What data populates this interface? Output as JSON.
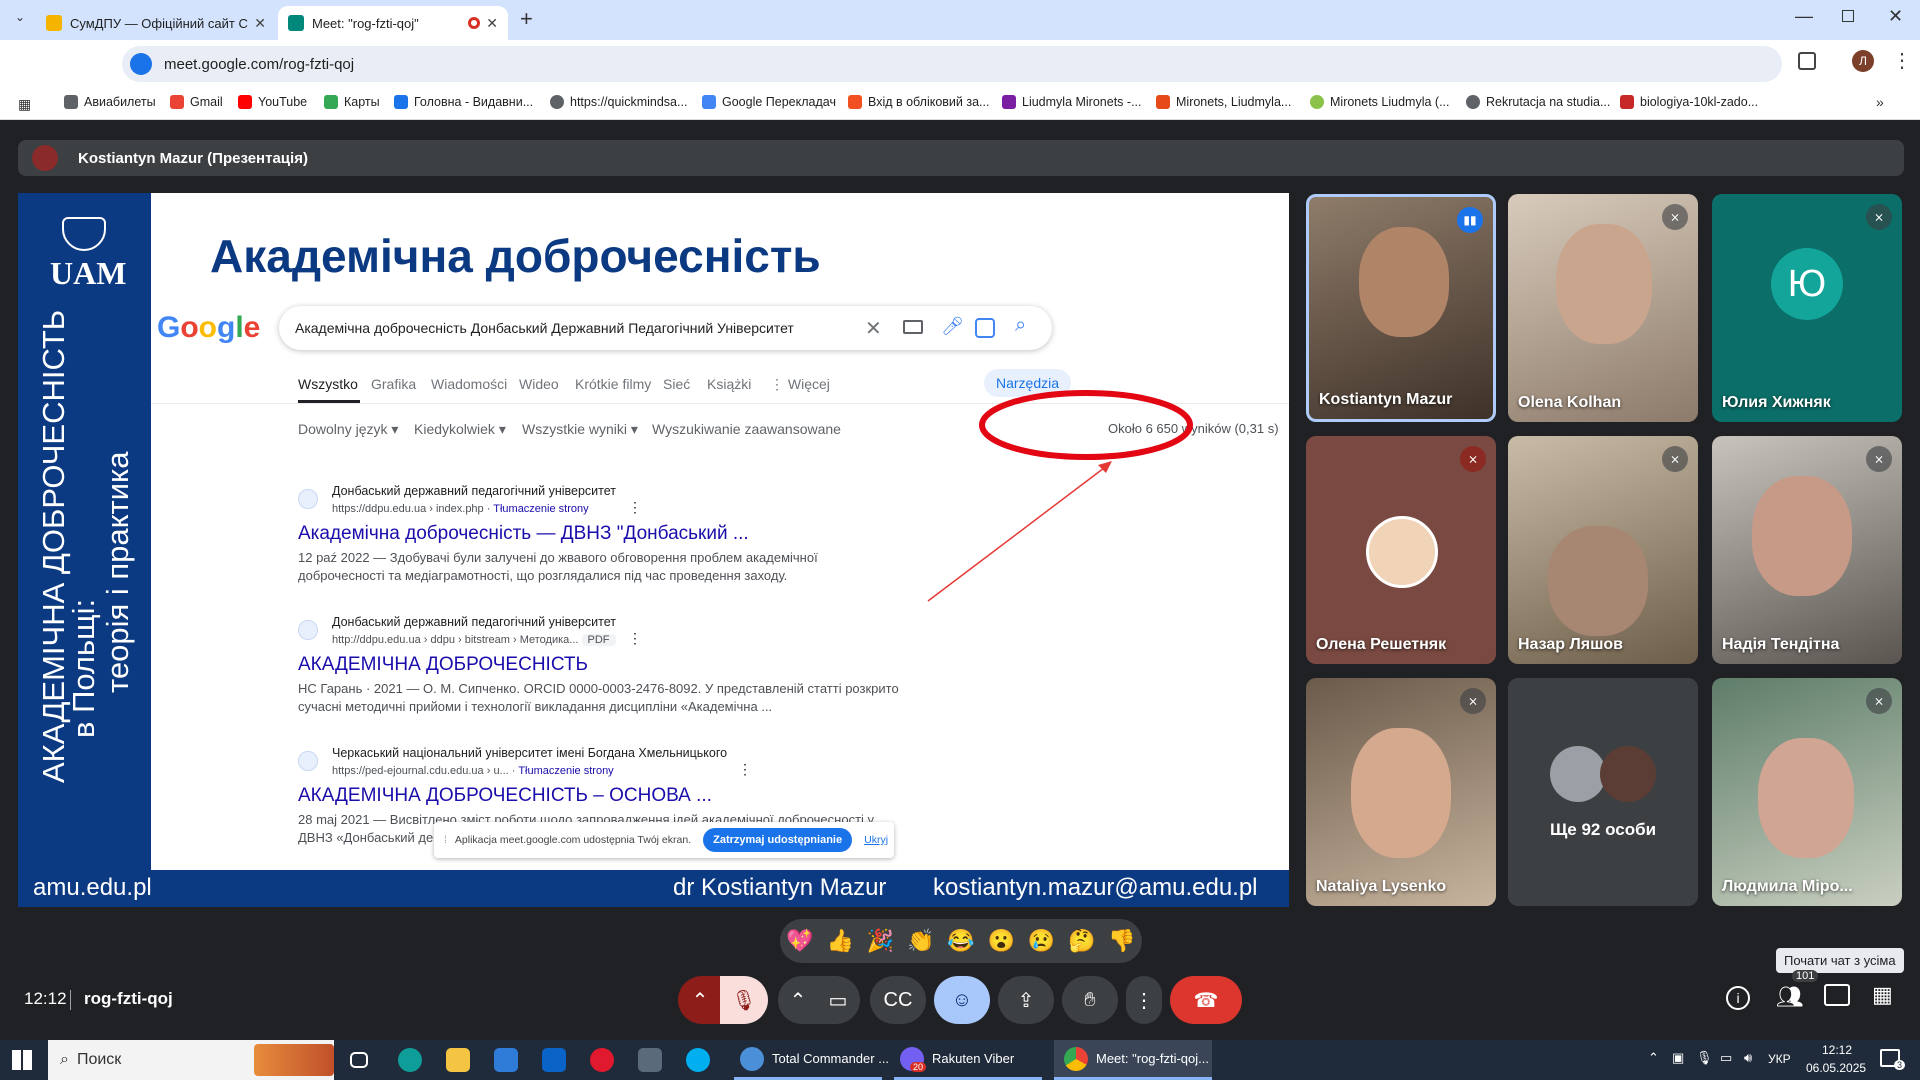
{
  "browser": {
    "tabs": [
      {
        "title": "СумДПУ — Офіційний сайт Сум",
        "active": false
      },
      {
        "title": "Meet: \"rog-fzti-qoj\"",
        "active": true
      }
    ],
    "address": "meet.google.com/rog-fzti-qoj",
    "bookmarks": [
      "Авиабилеты",
      "Gmail",
      "YouTube",
      "Карты",
      "Головна - Видавни...",
      "https://quickmindsa...",
      "Google Перекладач",
      "Вхід в обліковий за...",
      "Liudmyla Mironets -...",
      "Mironets, Liudmyla...",
      "Mironets Liudmyla (...",
      "Rekrutacja na studia...",
      "biologiya-10kl-zado..."
    ]
  },
  "meet": {
    "presenter_label": "Kostiantyn Mazur (Презентація)",
    "meeting_time": "12:12",
    "meeting_code": "rog-fzti-qoj",
    "chat_tooltip": "Почати чат з усіма",
    "participant_count": "101",
    "tiles": [
      {
        "name": "Kostiantyn Mazur"
      },
      {
        "name": "Olena Kolhan"
      },
      {
        "name": "Юлия Хижняк",
        "initial": "Ю"
      },
      {
        "name": "Олена Решетняк"
      },
      {
        "name": "Назар Ляшов"
      },
      {
        "name": "Надія Тендітна"
      },
      {
        "name": "Nataliya Lysenko"
      },
      {
        "name": "Ще 92 особи"
      },
      {
        "name": "Людмила Міро..."
      }
    ],
    "reactions": [
      "💖",
      "👍",
      "🎉",
      "👏",
      "😂",
      "😮",
      "😢",
      "🤔",
      "👎"
    ]
  },
  "slide": {
    "logo": "UAM",
    "title": "Академічна доброчесність",
    "vertical_line1": "АКАДЕМІЧНА ДОБРОЧЕСНІСТЬ",
    "vertical_line2": "в Польщі:",
    "vertical_line3": "теорія і практика",
    "footer_left": "amu.edu.pl",
    "footer_name": "dr Kostiantyn Mazur",
    "footer_email": "kostiantyn.mazur@amu.edu.pl",
    "google": {
      "logo": "Google",
      "query": "Академічна доброчесність Донбаський Державний Педагогічний Університет",
      "tabs": [
        "Wszystko",
        "Grafika",
        "Wiadomości",
        "Wideo",
        "Krótkie filmy",
        "Sieć",
        "Książki",
        "⋮ Więcej"
      ],
      "tools": "Narzędzia",
      "filters": [
        "Dowolny język",
        "Kiedykolwiek",
        "Wszystkie wyniki",
        "Wyszukiwanie zaawansowane"
      ],
      "result_count": "Około 6 650 wyników (0,31 s)",
      "results": [
        {
          "site": "Донбаський державний педагогічний університет",
          "url": "https://ddpu.edu.ua › index.php",
          "translate": "Tłumaczenie strony",
          "title": "Академічна доброчесність — ДВНЗ \"Донбаський ...",
          "snippet1": "12 paź 2022 — Здобувачі були залучені до жвавого обговорення проблем академічної",
          "snippet2": "доброчесності та медіаграмотності, що розглядалися під час проведення заходу."
        },
        {
          "site": "Донбаський державний педагогічний університет",
          "url": "http://ddpu.edu.ua › ddpu › bitstream › Методика...",
          "badge": "PDF",
          "title": "АКАДЕМІЧНА ДОБРОЧЕСНІСТЬ",
          "snippet1": "НС Гарань · 2021 — О. М. Сипченко. ORCID 0000-0003-2476-8092. У представленій статті розкрито",
          "snippet2": "сучасні методичні прийоми і технології викладання дисципліни «Академічна ..."
        },
        {
          "site": "Черкаський національний університет імені Богдана Хмельницького",
          "url": "https://ped-ejournal.cdu.edu.ua › u...",
          "translate": "Tłumaczenie strony",
          "title": "АКАДЕМІЧНА ДОБРОЧЕСНІСТЬ – ОСНОВА ...",
          "snippet1": "28 maj 2021 — Висвітлено зміст роботи щодо запровадження ідей академічної доброчесності у",
          "snippet2": "ДВНЗ «Донбаський де..."
        }
      ],
      "share_notice": "Aplikacja meet.google.com udostępnia Twój ekran.",
      "stop_share": "Zatrzymaj udostępnianie",
      "hide": "Ukryj"
    }
  },
  "taskbar": {
    "search": "Поиск",
    "apps": [
      "Total Commander ...",
      "Rakuten Viber",
      "Meet: \"rog-fzti-qoj..."
    ],
    "viber_badge": "20",
    "lang": "УКР",
    "time": "12:12",
    "date": "06.05.2025",
    "notif": "3"
  }
}
